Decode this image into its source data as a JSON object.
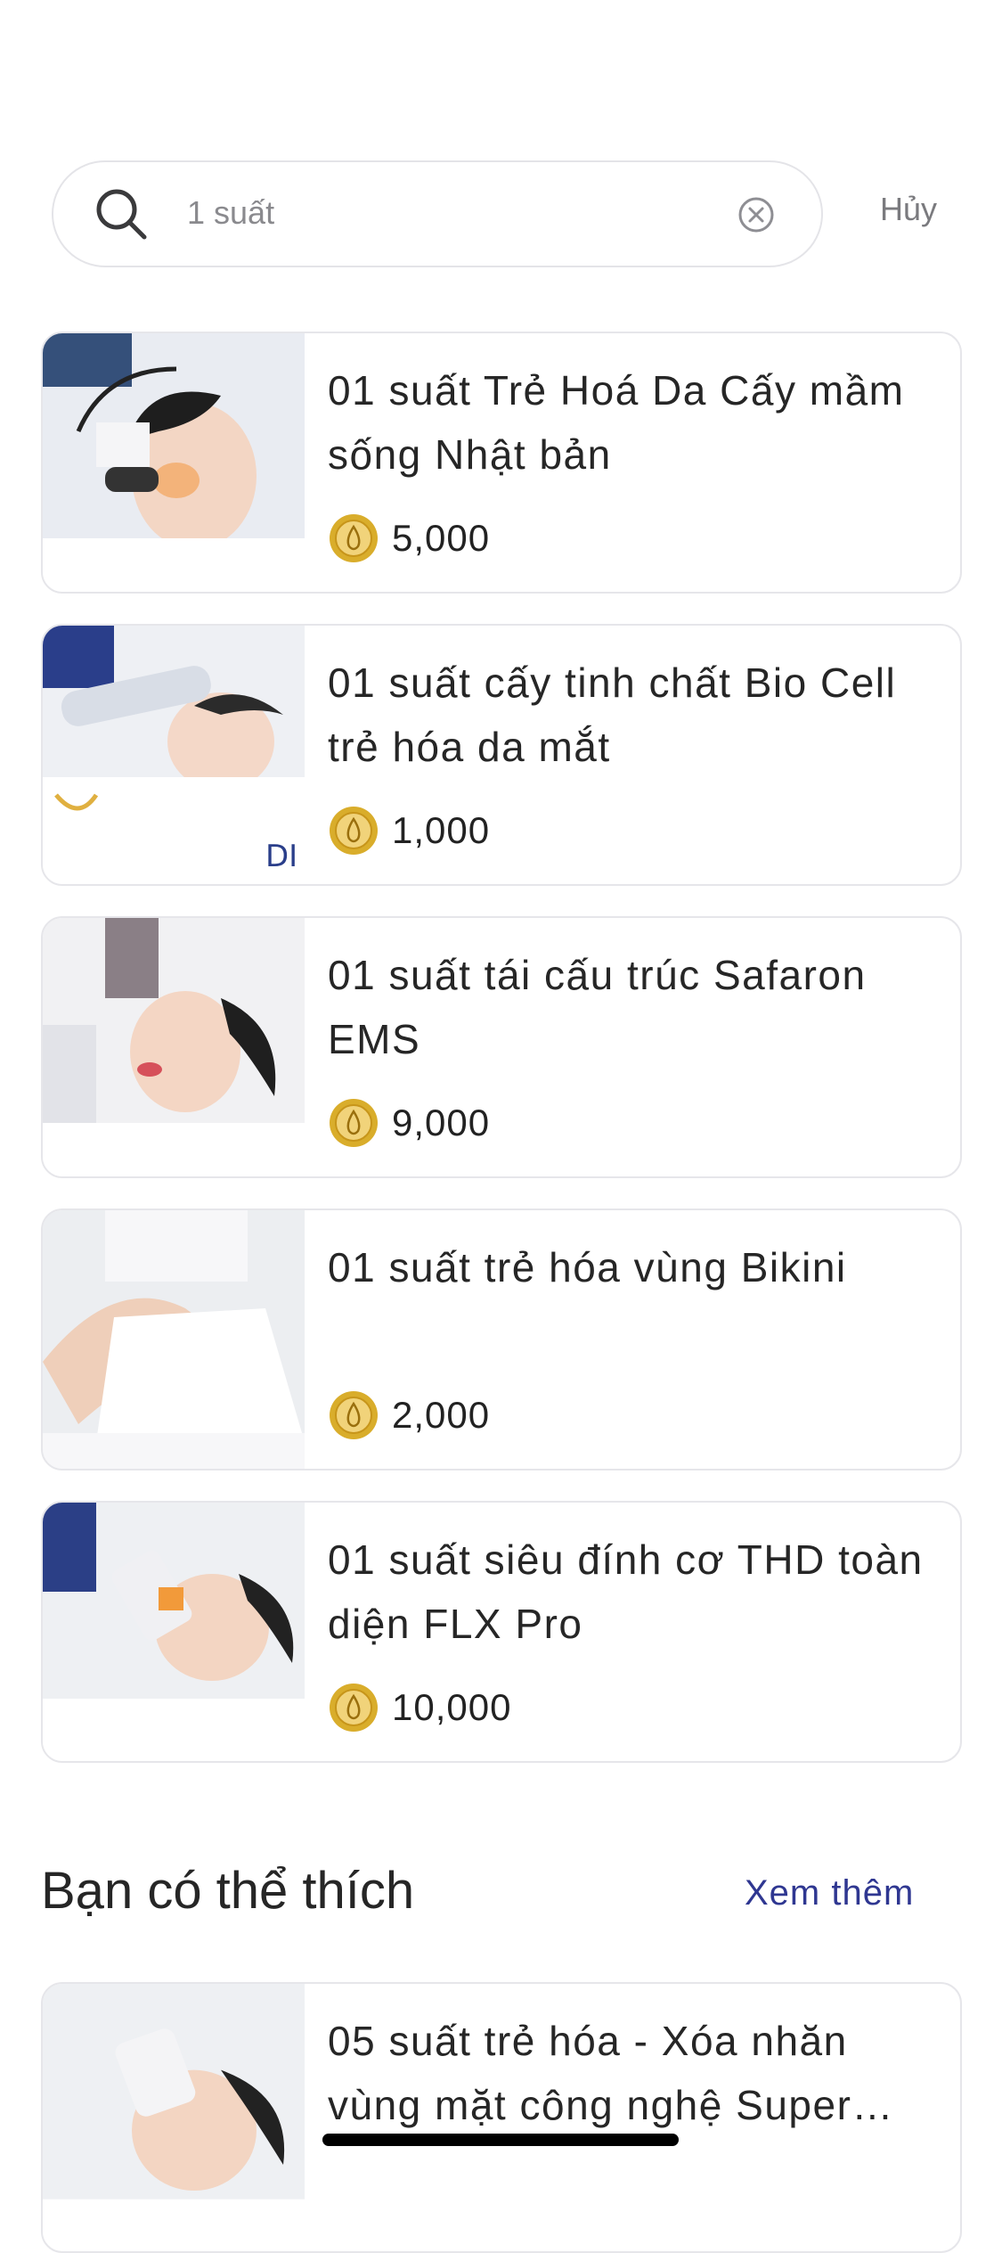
{
  "search": {
    "value": "1 suất",
    "cancel_label": "Hủy"
  },
  "results": [
    {
      "title": "01 suất Trẻ Hoá Da Cấy mầm sống Nhật bản",
      "price": "5,000"
    },
    {
      "title": "01 suất cấy tinh chất Bio Cell trẻ hóa da mắt",
      "price": "1,000"
    },
    {
      "title": "01 suất tái cấu trúc Safaron EMS",
      "price": "9,000"
    },
    {
      "title": "01 suất trẻ hóa vùng Bikini",
      "price": "2,000"
    },
    {
      "title": "01 suất siêu đính cơ THD toàn diện FLX Pro",
      "price": "10,000"
    }
  ],
  "suggestions": {
    "title": "Bạn có thể thích",
    "see_more_label": "Xem thêm",
    "items": [
      {
        "title": "05 suất trẻ hóa - Xóa nhăn vùng mặt công nghệ Super…"
      }
    ]
  },
  "colors": {
    "accent": "#2f3791",
    "coin": "#d9ad2b",
    "card_border": "#e6e6ea"
  },
  "icons": {
    "search": "search-icon",
    "clear": "clear-icon",
    "coin": "coin-icon"
  }
}
